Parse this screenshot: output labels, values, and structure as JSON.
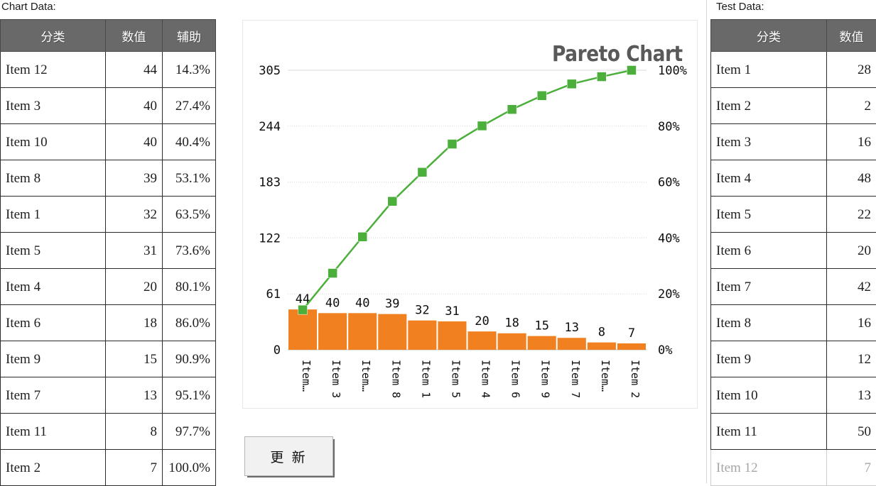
{
  "labels": {
    "chart_data": "Chart Data:",
    "test_data": "Test Data:"
  },
  "buttons": {
    "update": "更 新"
  },
  "chart_data_table": {
    "headers": [
      "分类",
      "数值",
      "辅助"
    ],
    "rows": [
      {
        "name": "Item 12",
        "value": "44",
        "pct": "14.3%"
      },
      {
        "name": "Item 3",
        "value": "40",
        "pct": "27.4%"
      },
      {
        "name": "Item 10",
        "value": "40",
        "pct": "40.4%"
      },
      {
        "name": "Item 8",
        "value": "39",
        "pct": "53.1%"
      },
      {
        "name": "Item 1",
        "value": "32",
        "pct": "63.5%"
      },
      {
        "name": "Item 5",
        "value": "31",
        "pct": "73.6%"
      },
      {
        "name": "Item 4",
        "value": "20",
        "pct": "80.1%"
      },
      {
        "name": "Item 6",
        "value": "18",
        "pct": "86.0%"
      },
      {
        "name": "Item 9",
        "value": "15",
        "pct": "90.9%"
      },
      {
        "name": "Item 7",
        "value": "13",
        "pct": "95.1%"
      },
      {
        "name": "Item 11",
        "value": "8",
        "pct": "97.7%"
      },
      {
        "name": "Item 2",
        "value": "7",
        "pct": "100.0%"
      }
    ]
  },
  "test_data_table": {
    "headers": [
      "分类",
      "数值"
    ],
    "rows": [
      {
        "name": "Item 1",
        "value": "28",
        "dimmed": false
      },
      {
        "name": "Item 2",
        "value": "2",
        "dimmed": false
      },
      {
        "name": "Item 3",
        "value": "16",
        "dimmed": false
      },
      {
        "name": "Item 4",
        "value": "48",
        "dimmed": false
      },
      {
        "name": "Item 5",
        "value": "22",
        "dimmed": false
      },
      {
        "name": "Item 6",
        "value": "20",
        "dimmed": false
      },
      {
        "name": "Item 7",
        "value": "42",
        "dimmed": false
      },
      {
        "name": "Item 8",
        "value": "16",
        "dimmed": false
      },
      {
        "name": "Item 9",
        "value": "12",
        "dimmed": false
      },
      {
        "name": "Item 10",
        "value": "13",
        "dimmed": false
      },
      {
        "name": "Item 11",
        "value": "50",
        "dimmed": false
      },
      {
        "name": "Item 12",
        "value": "7",
        "dimmed": true
      }
    ]
  },
  "chart_data": {
    "type": "bar",
    "title": "Pareto Chart",
    "xlabel": "",
    "ylabel": "",
    "grid": true,
    "legend": "none",
    "categories": [
      "Item 12",
      "Item 3",
      "Item 10",
      "Item 8",
      "Item 1",
      "Item 5",
      "Item 4",
      "Item 6",
      "Item 9",
      "Item 7",
      "Item 11",
      "Item 2"
    ],
    "category_tick_labels": [
      "Item…",
      "Item 3",
      "Item…",
      "Item 8",
      "Item 1",
      "Item 5",
      "Item 4",
      "Item 6",
      "Item 9",
      "Item 7",
      "Item…",
      "Item 2"
    ],
    "series": [
      {
        "name": "数值",
        "type": "bar",
        "color": "#F08020",
        "axis": "left",
        "values": [
          44,
          40,
          40,
          39,
          32,
          31,
          20,
          18,
          15,
          13,
          8,
          7
        ],
        "data_labels": [
          "44",
          "40",
          "40",
          "39",
          "32",
          "31",
          "20",
          "18",
          "15",
          "13",
          "8",
          "7"
        ]
      },
      {
        "name": "辅助",
        "type": "line",
        "color": "#4CAF3C",
        "axis": "right",
        "values": [
          14.3,
          27.4,
          40.4,
          53.1,
          63.5,
          73.6,
          80.1,
          86.0,
          90.9,
          95.1,
          97.7,
          100.0
        ]
      }
    ],
    "y_left": {
      "ticks": [
        "0",
        "61",
        "122",
        "183",
        "244",
        "305"
      ],
      "tick_values": [
        0,
        61,
        122,
        183,
        244,
        305
      ],
      "min": 0,
      "max": 305
    },
    "y_right": {
      "ticks": [
        "0%",
        "20%",
        "40%",
        "60%",
        "80%",
        "100%"
      ],
      "tick_values": [
        0,
        20,
        40,
        60,
        80,
        100
      ],
      "min": 0,
      "max": 100
    }
  },
  "colors": {
    "bar": "#F08020",
    "line": "#4CAF3C",
    "header_bg": "#696969",
    "title": "#595959"
  }
}
